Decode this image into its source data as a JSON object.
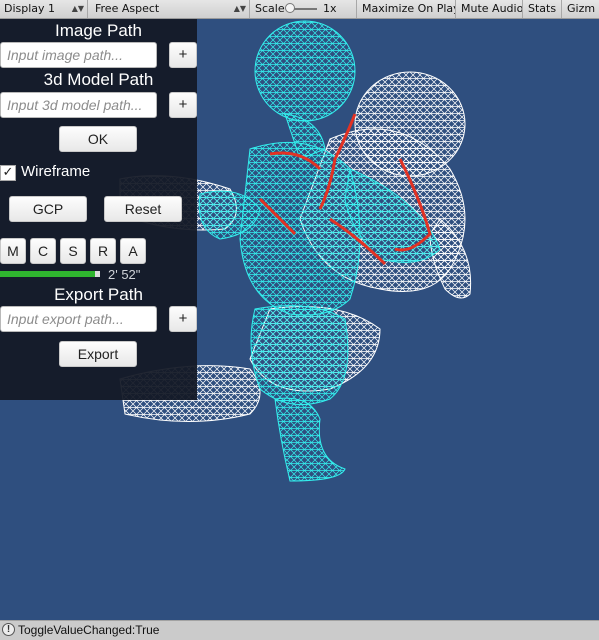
{
  "toolbar": {
    "display": "Display 1",
    "aspect": "Free Aspect",
    "scale_label": "Scale",
    "scale_value": "1x",
    "maximize_on_play": "Maximize On Play",
    "mute_audio": "Mute Audio",
    "stats": "Stats",
    "gizmos": "Gizm"
  },
  "panel": {
    "image_path_label": "Image Path",
    "image_path_placeholder": "Input image path...",
    "model_path_label": "3d Model Path",
    "model_path_placeholder": "Input 3d model path...",
    "add_label": "+",
    "ok_label": "OK",
    "wireframe_label": "Wireframe",
    "wireframe_checked": true,
    "gcp_label": "GCP",
    "reset_label": "Reset",
    "mode_buttons": [
      "M",
      "C",
      "S",
      "R",
      "A"
    ],
    "progress_fraction": 0.95,
    "time_text": "2'  52\"",
    "export_path_label": "Export Path",
    "export_path_placeholder": "Input export path...",
    "export_label": "Export"
  },
  "status": {
    "message": "ToggleValueChanged:True"
  },
  "colors": {
    "background": "#2f4f7f",
    "panel": "#141a26",
    "mesh_cyan": "#33f0ee",
    "mesh_white": "#ffffff",
    "mesh_red": "#e23224",
    "progress": "#2fb52f"
  }
}
